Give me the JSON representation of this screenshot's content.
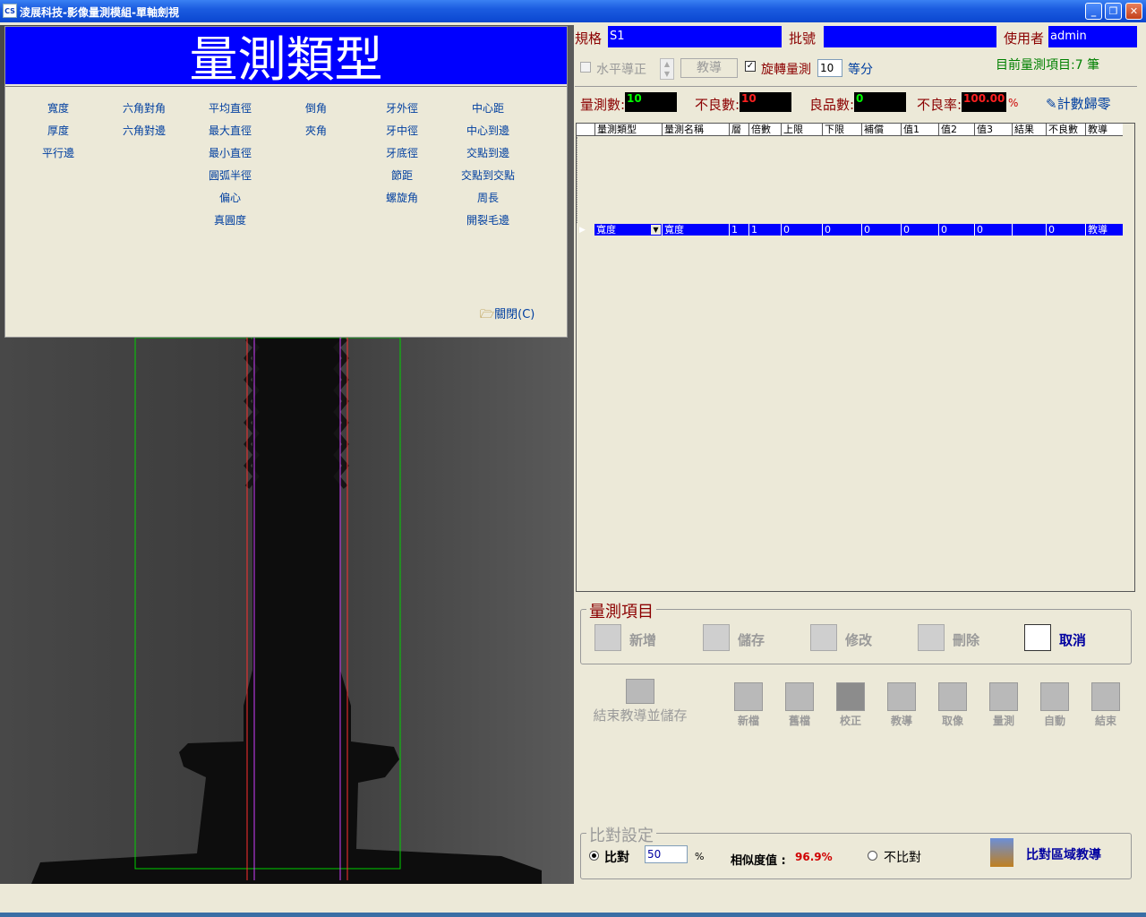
{
  "window": {
    "title": "淩展科技-影像量測模組-單軸劍視",
    "minimize": "_",
    "restore": "❐",
    "close": "✕"
  },
  "panel": {
    "banner": "量測類型",
    "types_col1": [
      "寬度",
      "厚度",
      "平行邊"
    ],
    "types_col2": [
      "六角對角",
      "六角對邊"
    ],
    "types_col3": [
      "平均直徑",
      "最大直徑",
      "最小直徑",
      "圓弧半徑",
      "偏心",
      "真圓度"
    ],
    "types_col4": [
      "倒角",
      "夾角"
    ],
    "types_col5": [
      "牙外徑",
      "牙中徑",
      "牙底徑",
      "節距",
      "螺旋角"
    ],
    "types_col6": [
      "中心距",
      "中心到邊",
      "交點到邊",
      "交點到交點",
      "周長",
      "開裂毛邊"
    ],
    "close_label": "關閉(C)"
  },
  "header": {
    "spec_label": "規格",
    "spec_value": "S1",
    "lot_label": "批號",
    "lot_value": "",
    "user_label": "使用者",
    "user_value": "admin"
  },
  "options": {
    "level_label": "水平導正",
    "teach_label": "教導",
    "rotate_label": "旋轉量測",
    "rotate_value": "10",
    "divide_label": "等分",
    "current_items": "目前量測項目:7 筆"
  },
  "counts": {
    "measure_label": "量測數:",
    "measure_value": "10",
    "bad_label": "不良數:",
    "bad_value": "10",
    "good_label": "良品數:",
    "good_value": "0",
    "rate_label": "不良率:",
    "rate_value": "100.00",
    "percent": "%",
    "reset_label": "計數歸零"
  },
  "grid": {
    "columns": [
      "量測類型",
      "量測名稱",
      "層",
      "倍數",
      "上限",
      "下限",
      "補償",
      "值1",
      "值2",
      "值3",
      "結果",
      "不良數",
      "教導"
    ],
    "row": [
      "寬度",
      "寬度",
      "1",
      "1",
      "0",
      "0",
      "0",
      "0",
      "0",
      "0",
      "",
      "0",
      "教導"
    ]
  },
  "items_group": {
    "title": "量測項目",
    "new": "新增",
    "save": "儲存",
    "edit": "修改",
    "delete": "刪除",
    "cancel": "取消"
  },
  "toolbar": {
    "finish_label": "結束教導並儲存",
    "buttons": [
      "新檔",
      "舊檔",
      "校正",
      "教導",
      "取像",
      "量測",
      "自動",
      "結束"
    ]
  },
  "compare": {
    "title": "比對設定",
    "compare_label": "比對",
    "compare_value": "50",
    "percent": "%",
    "similarity_label": "相似度值 :",
    "similarity_value": "96.9%",
    "no_compare_label": "不比對",
    "teach_label": "比對區域教導"
  },
  "colors": {
    "accent": "#0000ff",
    "title_bar": "#0a46d0",
    "label_red": "#8b0000"
  }
}
